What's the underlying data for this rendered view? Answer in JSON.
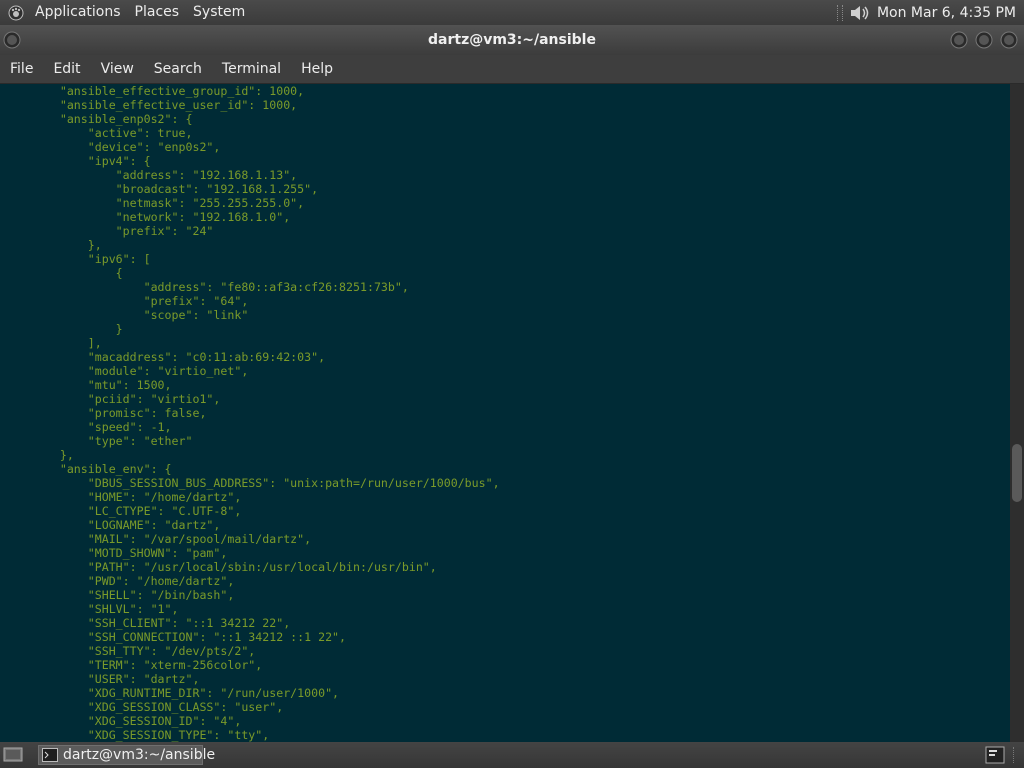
{
  "top_panel": {
    "menus": [
      "Applications",
      "Places",
      "System"
    ],
    "clock": "Mon Mar  6,  4:35 PM"
  },
  "window": {
    "title": "dartz@vm3:~/ansible"
  },
  "menubar": [
    "File",
    "Edit",
    "View",
    "Search",
    "Terminal",
    "Help"
  ],
  "terminal": {
    "lines": [
      "        \"ansible_effective_group_id\": 1000,",
      "        \"ansible_effective_user_id\": 1000,",
      "        \"ansible_enp0s2\": {",
      "            \"active\": true,",
      "            \"device\": \"enp0s2\",",
      "            \"ipv4\": {",
      "                \"address\": \"192.168.1.13\",",
      "                \"broadcast\": \"192.168.1.255\",",
      "                \"netmask\": \"255.255.255.0\",",
      "                \"network\": \"192.168.1.0\",",
      "                \"prefix\": \"24\"",
      "            },",
      "            \"ipv6\": [",
      "                {",
      "                    \"address\": \"fe80::af3a:cf26:8251:73b\",",
      "                    \"prefix\": \"64\",",
      "                    \"scope\": \"link\"",
      "                }",
      "            ],",
      "            \"macaddress\": \"c0:11:ab:69:42:03\",",
      "            \"module\": \"virtio_net\",",
      "            \"mtu\": 1500,",
      "            \"pciid\": \"virtio1\",",
      "            \"promisc\": false,",
      "            \"speed\": -1,",
      "            \"type\": \"ether\"",
      "        },",
      "        \"ansible_env\": {",
      "            \"DBUS_SESSION_BUS_ADDRESS\": \"unix:path=/run/user/1000/bus\",",
      "            \"HOME\": \"/home/dartz\",",
      "            \"LC_CTYPE\": \"C.UTF-8\",",
      "            \"LOGNAME\": \"dartz\",",
      "            \"MAIL\": \"/var/spool/mail/dartz\",",
      "            \"MOTD_SHOWN\": \"pam\",",
      "            \"PATH\": \"/usr/local/sbin:/usr/local/bin:/usr/bin\",",
      "            \"PWD\": \"/home/dartz\",",
      "            \"SHELL\": \"/bin/bash\",",
      "            \"SHLVL\": \"1\",",
      "            \"SSH_CLIENT\": \"::1 34212 22\",",
      "            \"SSH_CONNECTION\": \"::1 34212 ::1 22\",",
      "            \"SSH_TTY\": \"/dev/pts/2\",",
      "            \"TERM\": \"xterm-256color\",",
      "            \"USER\": \"dartz\",",
      "            \"XDG_RUNTIME_DIR\": \"/run/user/1000\",",
      "            \"XDG_SESSION_CLASS\": \"user\",",
      "            \"XDG_SESSION_ID\": \"4\",",
      "            \"XDG_SESSION_TYPE\": \"tty\","
    ]
  },
  "taskbar": {
    "task_label": "dartz@vm3:~/ansible"
  },
  "colors": {
    "terminal_bg": "#002b36",
    "terminal_fg": "#7a9a2a"
  },
  "icons": [
    "gnome-foot-icon",
    "volume-icon",
    "window-menu-icon",
    "minimize-icon",
    "maximize-icon",
    "close-icon",
    "show-desktop-icon",
    "terminal-icon",
    "workspace-switcher-icon"
  ]
}
